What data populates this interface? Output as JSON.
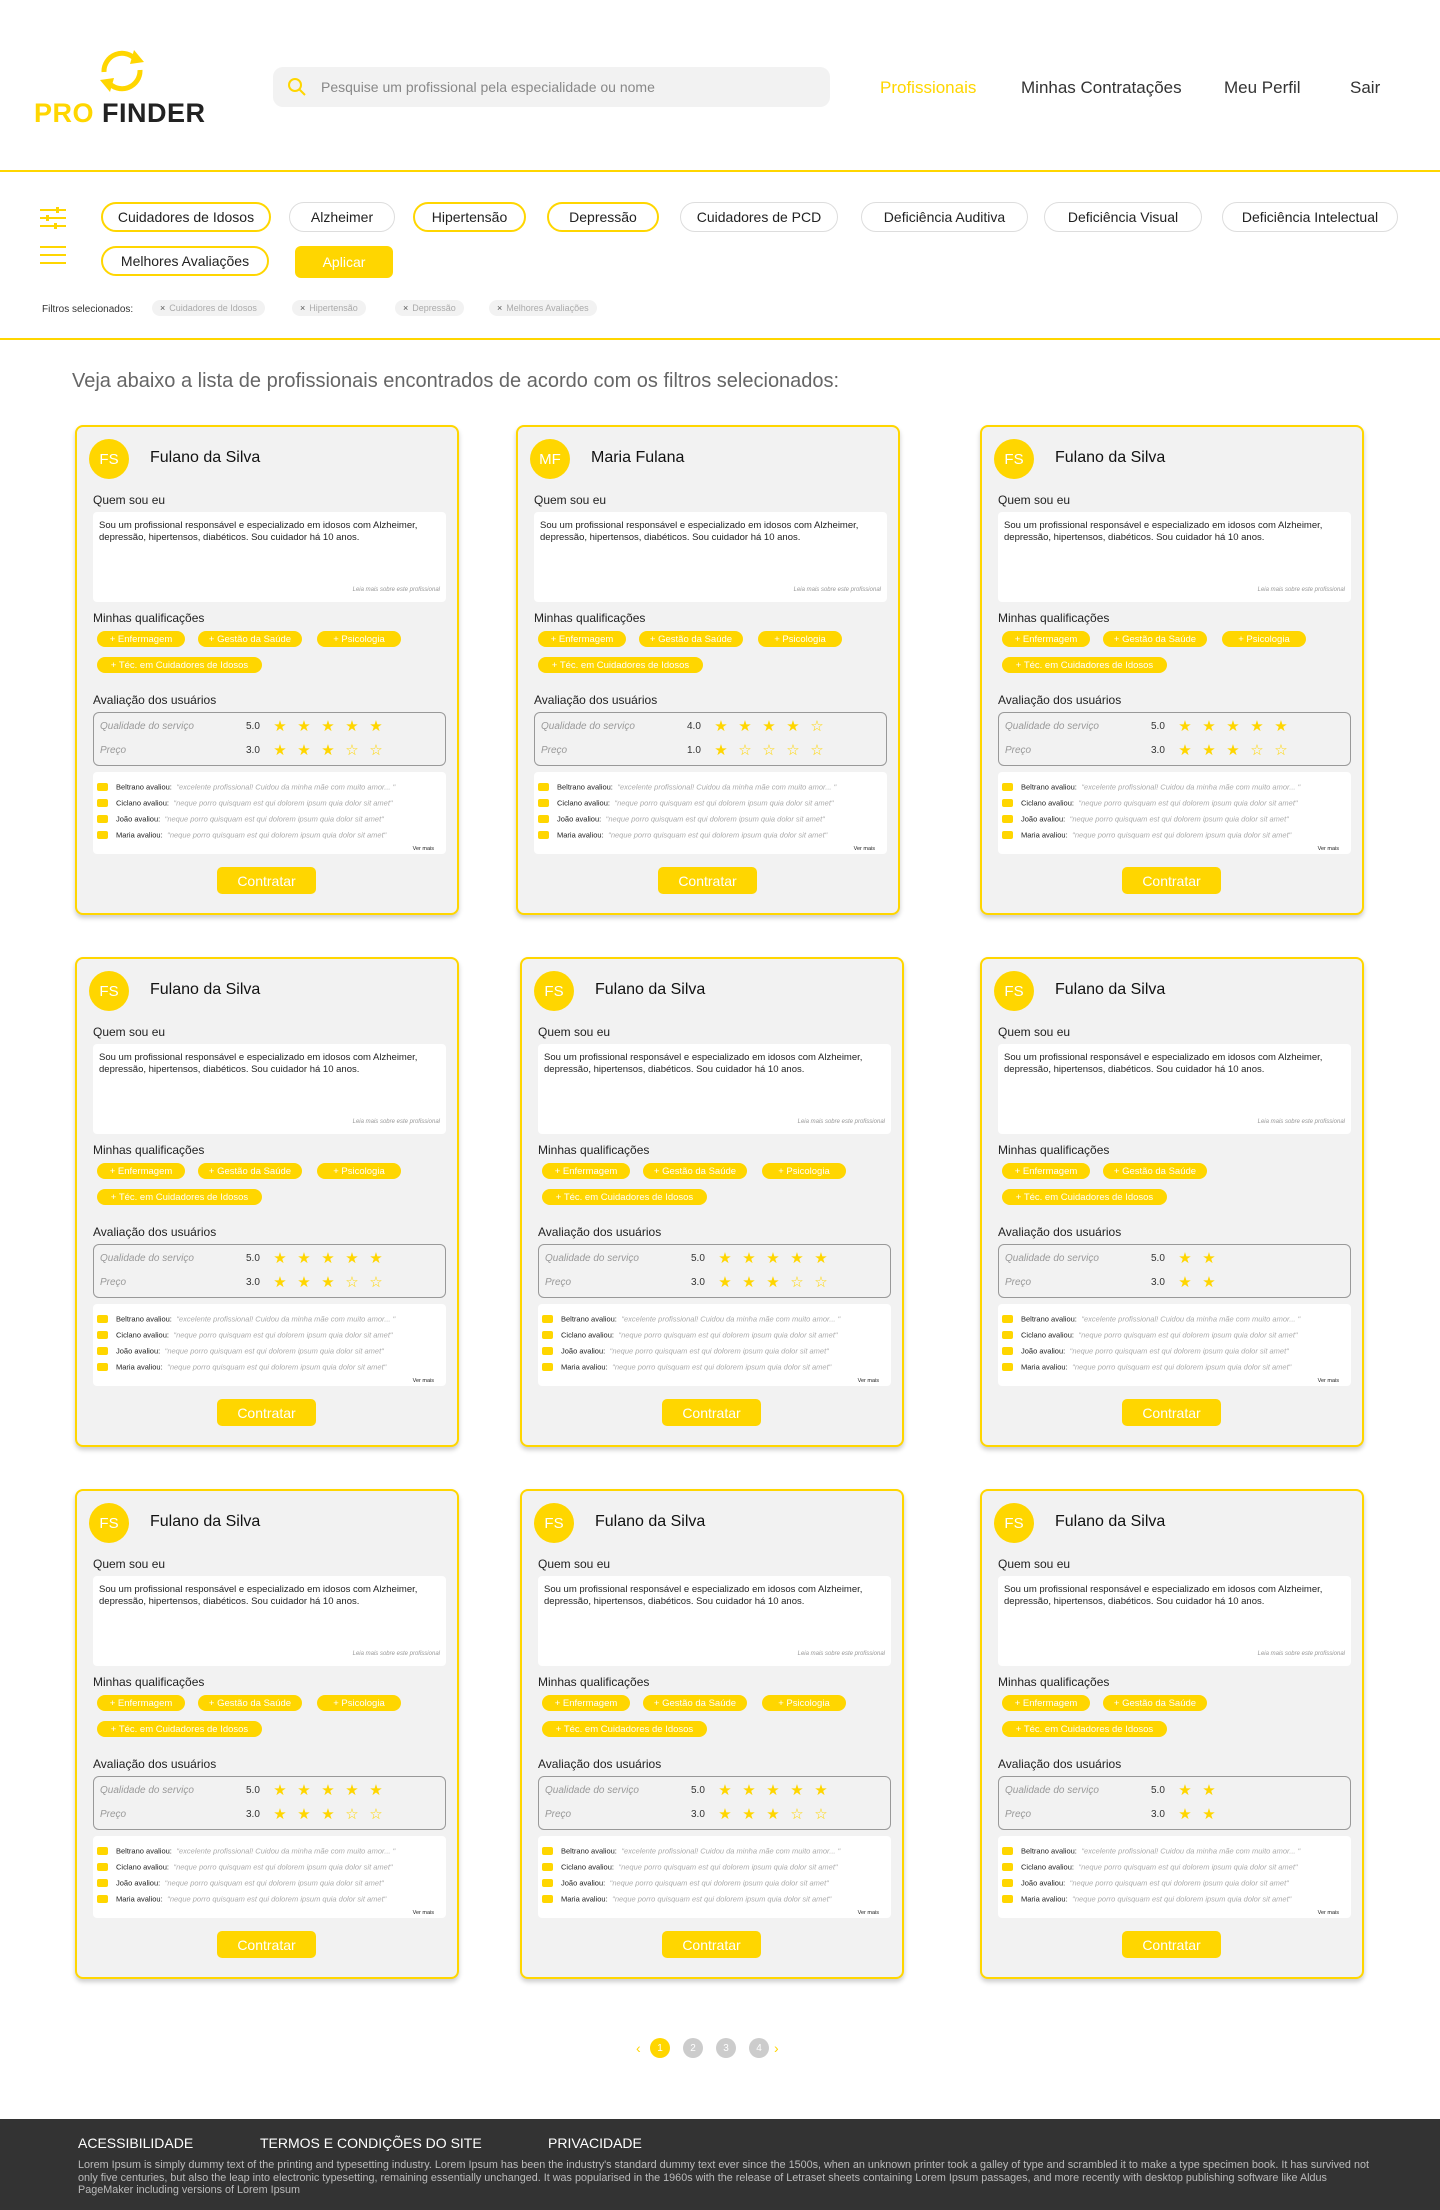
{
  "colors": {
    "accent": "#FFD600",
    "footer_bg": "#333333",
    "card_bg": "#f2f2f2"
  },
  "header": {
    "logo_pro": "PRO",
    "logo_finder": "FINDER",
    "search_placeholder": "Pesquise um profissional pela especialidade ou nome",
    "nav": [
      "Profissionais",
      "Minhas Contratações",
      "Meu Perfil",
      "Sair"
    ],
    "active_nav": "Profissionais"
  },
  "filters": {
    "chips": [
      "Cuidadores de Idosos",
      "Alzheimer",
      "Hipertensão",
      "Depressão",
      "Cuidadores de PCD",
      "Deficiência Auditiva",
      "Deficiência Visual",
      "Deficiência Intelectual",
      "Melhores Avaliações"
    ],
    "selected": [
      "Cuidadores de Idosos",
      "Hipertensão",
      "Depressão",
      "Melhores Avaliações"
    ],
    "apply_label": "Aplicar",
    "selected_label": "Filtros selecionados:",
    "selected_tags": [
      "Cuidadores de Idosos",
      "Hipertensão",
      "Depressão",
      "Melhores Avaliações"
    ]
  },
  "intro": "Veja abaixo a lista de profissionais encontrados de acordo com os filtros selecionados:",
  "card_labels": {
    "about": "Quem sou eu",
    "qualifications": "Minhas qualificações",
    "ratings": "Avaliação dos usuários",
    "service_quality": "Qualidade do serviço",
    "price": "Preço",
    "read_more": "Leia mais sobre este profissional",
    "see_more": "Ver mais",
    "hire": "Contratar"
  },
  "cards": [
    {
      "initials": "FS",
      "name": "Fulano da Silva",
      "bio": "Sou um profissional responsável e especializado em idosos com Alzheimer, depressão, hipertensos, diabéticos. Sou cuidador há 10 anos.",
      "qualifications": [
        "+ Enfermagem",
        "+ Gestão da Saúde",
        "+ Psicologia",
        "+ Téc. em Cuidadores de Idosos"
      ],
      "quality_score": "5.0",
      "quality_stars": 5,
      "quality_total": 5,
      "price_score": "3.0",
      "price_stars": 3,
      "price_total": 5
    },
    {
      "initials": "MF",
      "name": "Maria Fulana",
      "bio": "Sou um profissional responsável e especializado em idosos com Alzheimer, depressão, hipertensos, diabéticos. Sou cuidador há 10 anos.",
      "qualifications": [
        "+ Enfermagem",
        "+ Gestão da Saúde",
        "+ Psicologia",
        "+ Téc. em Cuidadores de Idosos"
      ],
      "quality_score": "4.0",
      "quality_stars": 4,
      "quality_total": 5,
      "price_score": "1.0",
      "price_stars": 1,
      "price_total": 5
    },
    {
      "initials": "FS",
      "name": "Fulano da Silva",
      "bio": "Sou um profissional responsável e especializado em idosos com Alzheimer, depressão, hipertensos, diabéticos. Sou cuidador há 10 anos.",
      "qualifications": [
        "+ Enfermagem",
        "+ Gestão da Saúde",
        "+ Psicologia",
        "+ Téc. em Cuidadores de Idosos"
      ],
      "quality_score": "5.0",
      "quality_stars": 5,
      "quality_total": 5,
      "price_score": "3.0",
      "price_stars": 3,
      "price_total": 5
    },
    {
      "initials": "FS",
      "name": "Fulano da Silva",
      "bio": "Sou um profissional responsável e especializado em idosos com Alzheimer, depressão, hipertensos, diabéticos. Sou cuidador há 10 anos.",
      "qualifications": [
        "+ Enfermagem",
        "+ Gestão da Saúde",
        "+ Psicologia",
        "+ Téc. em Cuidadores de Idosos"
      ],
      "quality_score": "5.0",
      "quality_stars": 5,
      "quality_total": 5,
      "price_score": "3.0",
      "price_stars": 3,
      "price_total": 5
    },
    {
      "initials": "FS",
      "name": "Fulano da Silva",
      "bio": "Sou um profissional responsável e especializado em idosos com Alzheimer, depressão, hipertensos, diabéticos. Sou cuidador há 10 anos.",
      "qualifications": [
        "+ Enfermagem",
        "+ Gestão da Saúde",
        "+ Psicologia",
        "+ Téc. em Cuidadores de Idosos"
      ],
      "quality_score": "5.0",
      "quality_stars": 5,
      "quality_total": 5,
      "price_score": "3.0",
      "price_stars": 3,
      "price_total": 5
    },
    {
      "initials": "FS",
      "name": "Fulano da Silva",
      "bio": "Sou um profissional responsável e especializado em idosos com Alzheimer, depressão, hipertensos, diabéticos. Sou cuidador há 10 anos.",
      "qualifications": [
        "+ Enfermagem",
        "+ Gestão da Saúde",
        "+ Téc. em Cuidadores de Idosos"
      ],
      "quality_score": "5.0",
      "quality_stars": 2,
      "quality_total": 2,
      "price_score": "3.0",
      "price_stars": 2,
      "price_total": 2
    },
    {
      "initials": "FS",
      "name": "Fulano da Silva",
      "bio": "Sou um profissional responsável e especializado em idosos com Alzheimer, depressão, hipertensos, diabéticos. Sou cuidador há 10 anos.",
      "qualifications": [
        "+ Enfermagem",
        "+ Gestão da Saúde",
        "+ Psicologia",
        "+ Téc. em Cuidadores de Idosos"
      ],
      "quality_score": "5.0",
      "quality_stars": 5,
      "quality_total": 5,
      "price_score": "3.0",
      "price_stars": 3,
      "price_total": 5
    },
    {
      "initials": "FS",
      "name": "Fulano da Silva",
      "bio": "Sou um profissional responsável e especializado em idosos com Alzheimer, depressão, hipertensos, diabéticos. Sou cuidador há 10 anos.",
      "qualifications": [
        "+ Enfermagem",
        "+ Gestão da Saúde",
        "+ Psicologia",
        "+ Téc. em Cuidadores de Idosos"
      ],
      "quality_score": "5.0",
      "quality_stars": 5,
      "quality_total": 5,
      "price_score": "3.0",
      "price_stars": 3,
      "price_total": 5
    },
    {
      "initials": "FS",
      "name": "Fulano da Silva",
      "bio": "Sou um profissional responsável e especializado em idosos com Alzheimer, depressão, hipertensos, diabéticos. Sou cuidador há 10 anos.",
      "qualifications": [
        "+ Enfermagem",
        "+ Gestão da Saúde",
        "+ Téc. em Cuidadores de Idosos"
      ],
      "quality_score": "5.0",
      "quality_stars": 2,
      "quality_total": 2,
      "price_score": "3.0",
      "price_stars": 2,
      "price_total": 2
    }
  ],
  "reviews": [
    {
      "who": "Beltrano avaliou:",
      "text": "\"excelente profissional! Cuidou da minha mãe com muito amor... \""
    },
    {
      "who": "Ciclano avaliou:",
      "text": "\"neque porro quisquam est qui dolorem ipsum quia dolor sit amet\""
    },
    {
      "who": "João avaliou:",
      "text": "\"neque porro quisquam est qui dolorem ipsum quia dolor sit amet\""
    },
    {
      "who": "Maria avaliou:",
      "text": "\"neque porro quisquam est qui dolorem ipsum quia dolor sit amet\""
    }
  ],
  "pagination": {
    "pages": [
      "1",
      "2",
      "3",
      "4"
    ],
    "current": "1",
    "prev": "‹",
    "next": "›"
  },
  "footer": {
    "links": [
      "ACESSIBILIDADE",
      "TERMOS E CONDIÇÕES DO SITE",
      "PRIVACIDADE"
    ],
    "text": "Lorem Ipsum is simply dummy text of the printing and typesetting industry. Lorem Ipsum has been the industry's standard dummy text ever since the 1500s, when an unknown printer took a galley of type and scrambled it to make a type specimen book. It has survived not only five centuries, but also the leap into electronic typesetting, remaining essentially unchanged. It was popularised in the 1960s with the release of Letraset sheets containing Lorem Ipsum passages, and more recently with desktop publishing software like Aldus PageMaker including versions of Lorem Ipsum"
  }
}
